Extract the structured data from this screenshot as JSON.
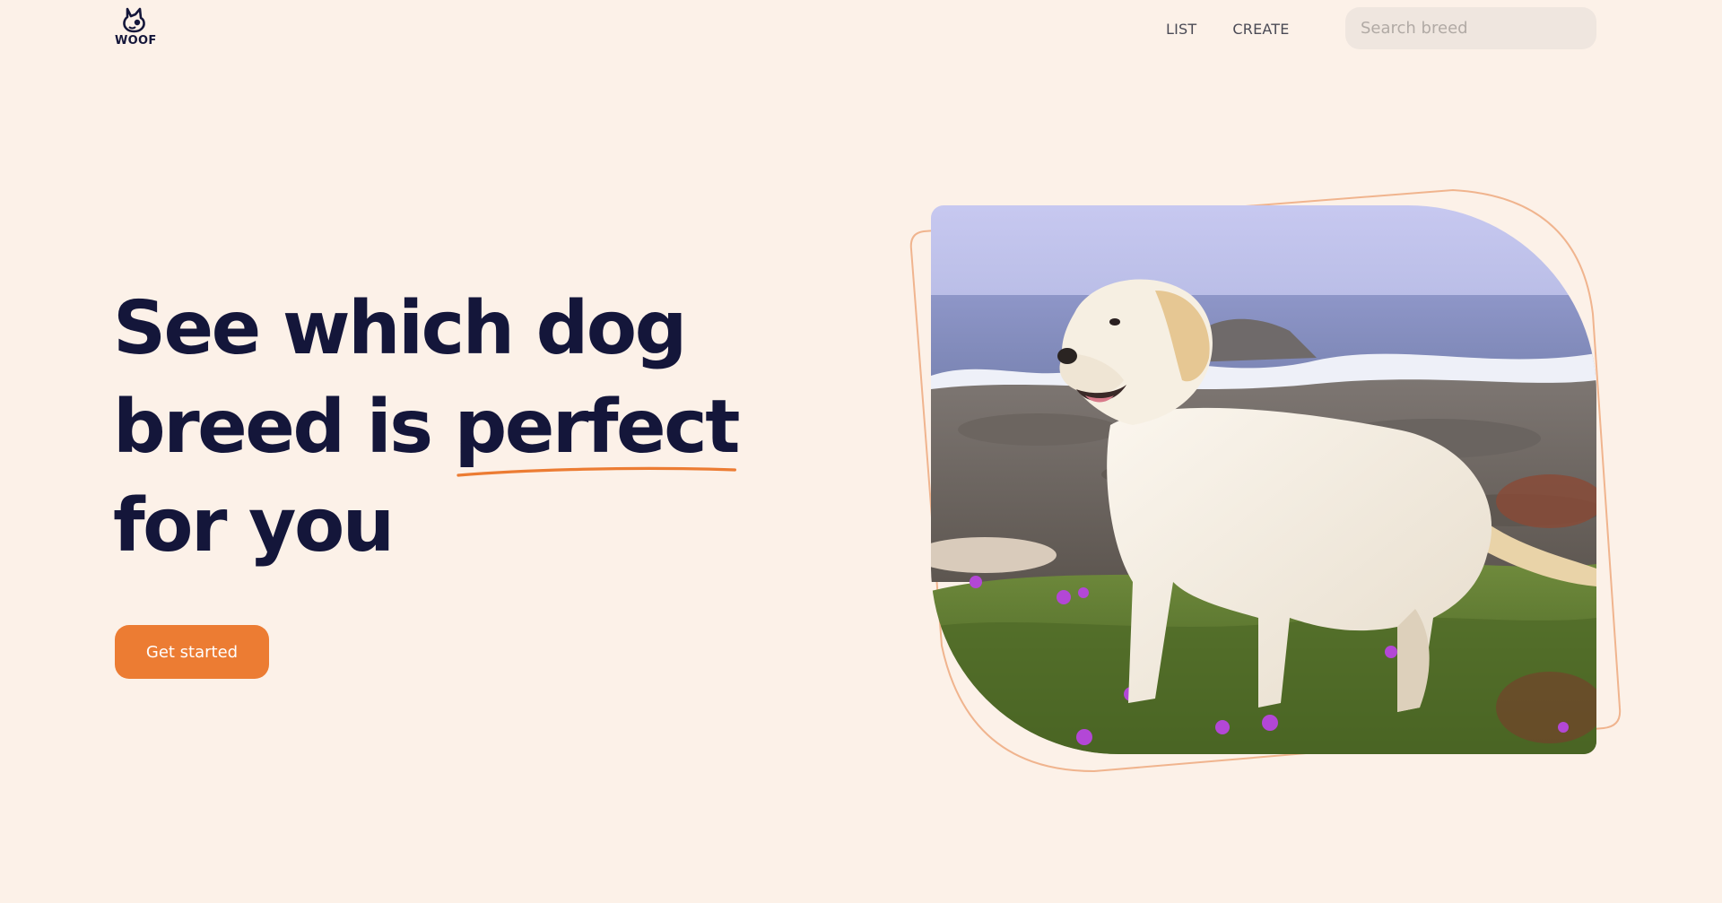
{
  "header": {
    "logo_text": "WOOF",
    "logo_icon": "dog-head-icon",
    "nav": [
      {
        "label": "LIST"
      },
      {
        "label": "CREATE"
      }
    ],
    "search": {
      "placeholder": "Search breed",
      "value": ""
    }
  },
  "hero": {
    "title_part1": "See which dog breed is ",
    "title_highlight": "perfect",
    "title_part2": " for you",
    "cta_label": "Get started",
    "image_description_icon": "labrador-photo"
  },
  "colors": {
    "background": "#fcf1e8",
    "text": "#14163a",
    "accent": "#ec7c33",
    "search_bg": "#efe6df",
    "frame_outline": "#f0b48e"
  }
}
